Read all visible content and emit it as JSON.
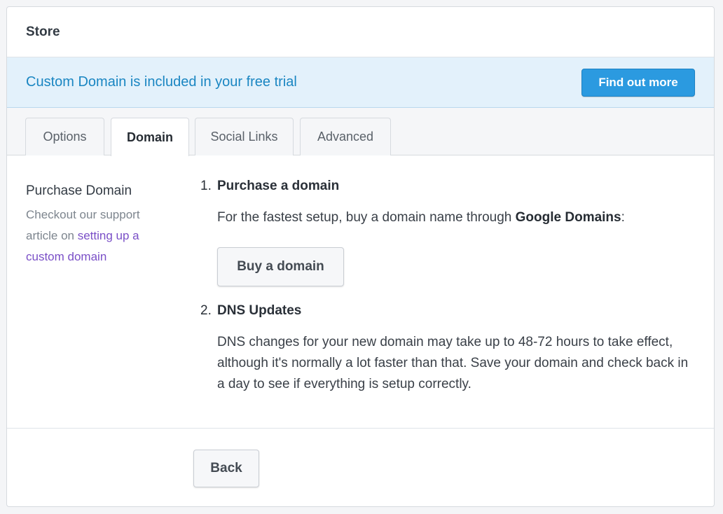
{
  "header": {
    "title": "Store"
  },
  "banner": {
    "text": "Custom Domain is included in your free trial",
    "button_label": "Find out more"
  },
  "tabs": [
    {
      "label": "Options",
      "active": false
    },
    {
      "label": "Domain",
      "active": true
    },
    {
      "label": "Social Links",
      "active": false
    },
    {
      "label": "Advanced",
      "active": false
    }
  ],
  "sidebar": {
    "title": "Purchase Domain",
    "desc_prefix": "Checkout our support article on ",
    "link_text": "setting up a custom domain"
  },
  "steps": [
    {
      "number": "1.",
      "title": "Purchase a domain",
      "text_prefix": "For the fastest setup, buy a domain name through ",
      "text_bold": "Google Domains",
      "text_suffix": ":",
      "button_label": "Buy a domain"
    },
    {
      "number": "2.",
      "title": "DNS Updates",
      "text": "DNS changes for your new domain may take up to 48-72 hours to take effect, although it's normally a lot faster than that. Save your domain and check back in a day to see if everything is setup correctly."
    }
  ],
  "footer": {
    "back_label": "Back"
  },
  "colors": {
    "accent": "#2b9ae0",
    "banner_bg": "#e3f1fb",
    "banner_text": "#1a86c2",
    "link": "#7a4fc7"
  }
}
